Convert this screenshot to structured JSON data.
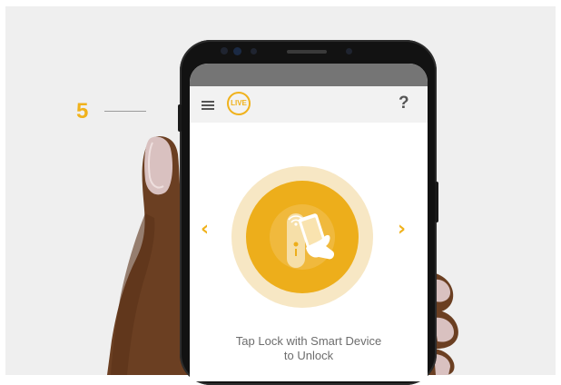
{
  "step": {
    "number": "5"
  },
  "app": {
    "logo_text": "LIVE",
    "help_label": "?",
    "prev_arrow": "‹",
    "next_arrow": "›",
    "instruction_line1": "Tap Lock with Smart Device",
    "instruction_line2": "to Unlock"
  },
  "icons": [
    "hamburger-menu-icon",
    "live-logo",
    "help-icon",
    "chevron-left-icon",
    "chevron-right-icon",
    "tap-lock-illustration"
  ],
  "colors": {
    "accent": "#f0b21c",
    "circle_inner": "#edae1b",
    "circle_outer": "#f7e7c4",
    "statusbar": "#757575",
    "appbar": "#f2f2f2",
    "text": "#6d6d6d"
  }
}
